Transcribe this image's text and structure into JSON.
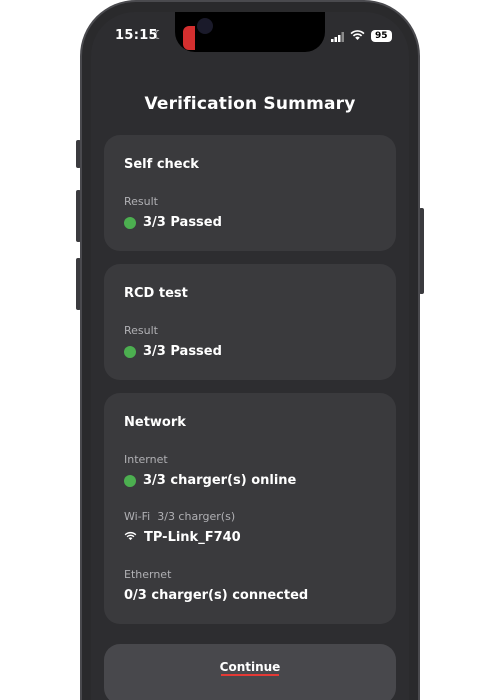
{
  "status_bar": {
    "time": "15:15",
    "battery": "95",
    "icons": [
      "moon-icon",
      "signal-icon",
      "wifi-icon",
      "battery-icon"
    ]
  },
  "page": {
    "title": "Verification Summary"
  },
  "cards": {
    "self_check": {
      "title": "Self check",
      "result_label": "Result",
      "result_value": "3/3 Passed",
      "status_color": "#4caf50"
    },
    "rcd_test": {
      "title": "RCD test",
      "result_label": "Result",
      "result_value": "3/3 Passed",
      "status_color": "#4caf50"
    },
    "network": {
      "title": "Network",
      "internet_label": "Internet",
      "internet_value": "3/3 charger(s) online",
      "wifi_label": "Wi-Fi  3/3 charger(s)",
      "wifi_ssid": "TP-Link_F740",
      "ethernet_label": "Ethernet",
      "ethernet_value": "0/3 charger(s) connected"
    }
  },
  "actions": {
    "continue_label": "Continue"
  },
  "colors": {
    "accent_green": "#4caf50",
    "background": "#2d2d30",
    "card": "#3a3a3d"
  }
}
